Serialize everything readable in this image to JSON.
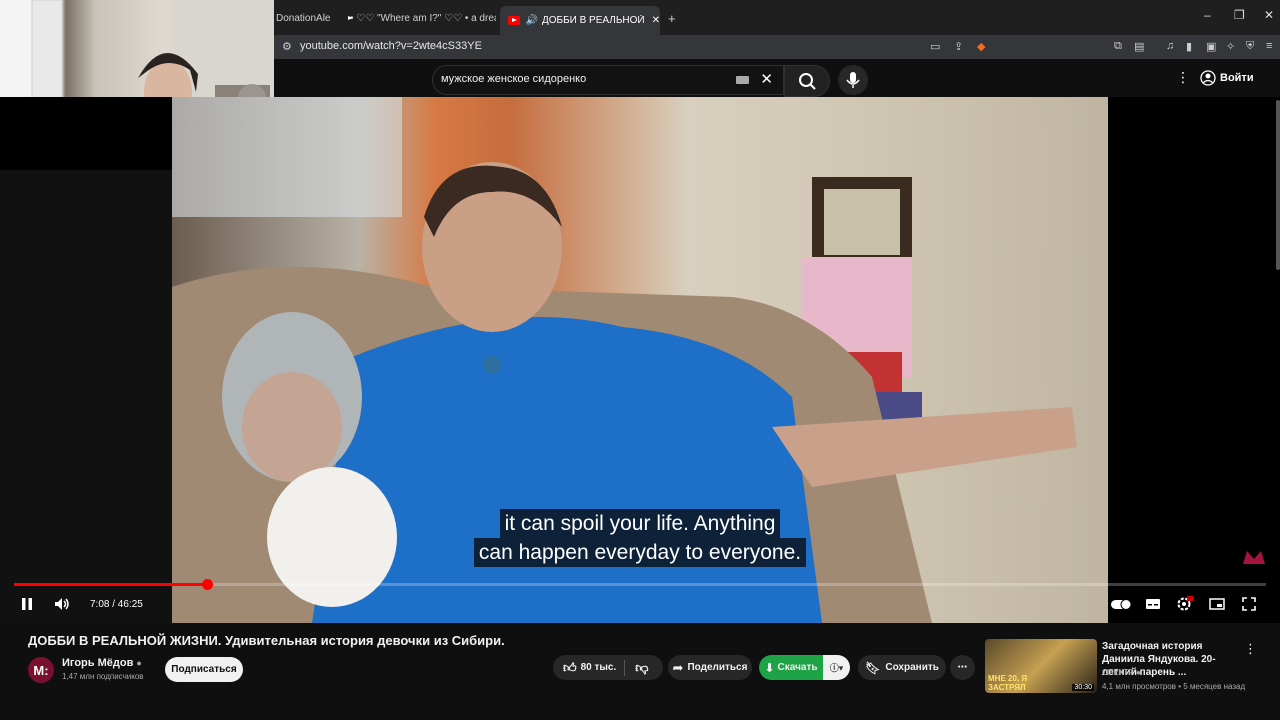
{
  "browser": {
    "tabs": [
      {
        "label": "DonationAlert"
      },
      {
        "label": "• ♡♡ \"Where am I?\" ♡♡ • a dreamco"
      },
      {
        "label": "ДОББИ В РЕАЛЬНОЙ ЖИЗНИ"
      }
    ],
    "url": "youtube.com/watch?v=2wte4cS33YE",
    "window_controls": {
      "minimize": "–",
      "restore": "❐",
      "close": "✕"
    }
  },
  "youtube": {
    "search_query": "мужское женское сидоренко",
    "login_label": "Войти"
  },
  "player": {
    "subtitle_lines": [
      "it can spoil your life. Anything",
      "can happen everyday to everyone."
    ],
    "time_current": "7:08",
    "time_total": "46:25",
    "time_display": "7:08 / 46:25",
    "progress_fraction": 0.154,
    "icons": [
      "pause-icon",
      "volume-icon",
      "autoplay-toggle-icon",
      "subtitles-icon",
      "settings-icon",
      "miniplayer-icon",
      "fullscreen-icon"
    ]
  },
  "video_info": {
    "title": "ДОББИ В РЕАЛЬНОЙ ЖИЗНИ. Удивительная история девочки из Сибири.",
    "channel_avatar_text": "M:",
    "channel_name": "Игорь Мёдов",
    "subscribers": "1,47 млн подписчиков",
    "subscribe_label": "Подписаться",
    "likes": "80 тыс.",
    "share_label": "Поделиться",
    "download_label": "Скачать",
    "save_label": "Сохранить"
  },
  "recommendation": {
    "title": "Загадочная история Даниила Яндукова. 20-летний парень ...",
    "channel": "СПЕКТР",
    "meta": "4,1 млн просмотров • 5 месяцев назад",
    "thumb_text": "МНЕ 20, Я ЗАСТРЯЛ",
    "duration": "30:30"
  },
  "colors": {
    "accent": "#ff0000",
    "download": "#1ea446",
    "background": "#0f0f0f"
  }
}
